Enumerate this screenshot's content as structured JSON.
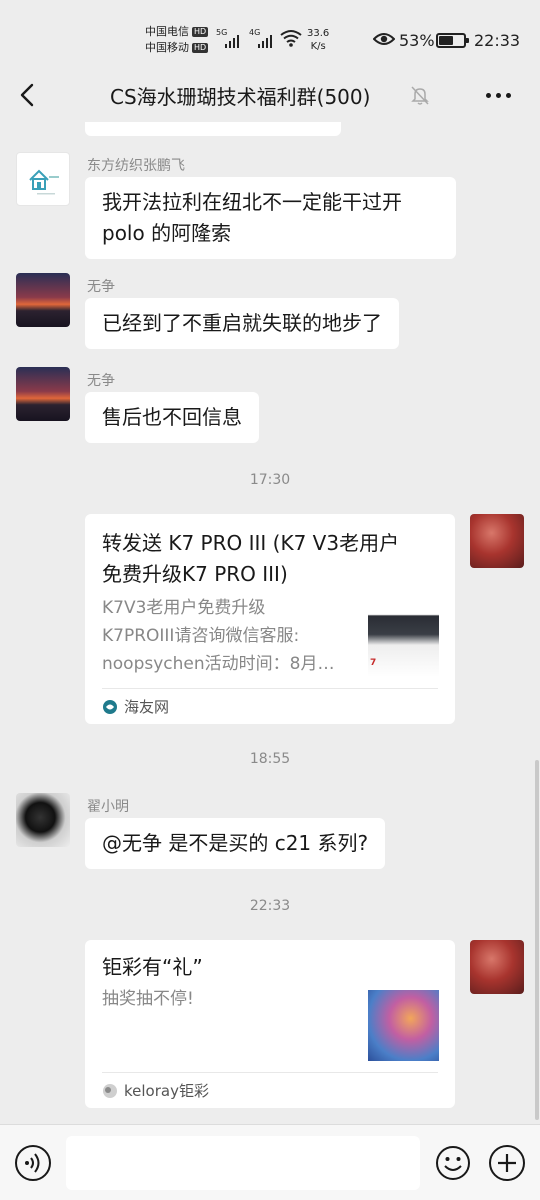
{
  "status_bar": {
    "carrier1": "中国电信",
    "carrier2": "中国移动",
    "hd_label": "HD",
    "sim1_network": "5G",
    "sim2_network": "4G",
    "net_speed_value": "33.6",
    "net_speed_unit": "K/s",
    "battery_percent": "53%",
    "battery_level": 0.53,
    "time": "22:33"
  },
  "header": {
    "title": "CS海水珊瑚技术福利群(500)"
  },
  "messages": [
    {
      "sender": "东方纺织张鹏飞",
      "text_line1": "我开法拉利在纽北不一定能干过开",
      "text_line2": "polo 的阿隆索"
    },
    {
      "sender": "无争",
      "text": "已经到了不重启就失联的地步了"
    },
    {
      "sender": "无争",
      "text": "售后也不回信息"
    },
    {
      "timestamp": "17:30"
    },
    {
      "title_line1": "转发送 K7 PRO III (K7 V3老用户",
      "title_line2": "免费升级K7 PRO III)",
      "desc_line1": "K7V3老用户免费升级",
      "desc_line2": "K7PROIII请咨询微信客服:",
      "desc_line3": "noopsychen活动时间：8月…",
      "source": "海友网"
    },
    {
      "timestamp": "18:55"
    },
    {
      "sender": "翟小明",
      "text": "@无争  是不是买的 c21 系列?"
    },
    {
      "timestamp": "22:33"
    },
    {
      "title": "钜彩有“礼”",
      "desc": "抽奖抽不停!",
      "source": "keloray钜彩"
    }
  ],
  "colors": {
    "background": "#ededed",
    "bubble": "#ffffff",
    "meta_text": "#8a8a8a"
  },
  "icons": {
    "back": "chevron-left-icon",
    "mute": "bell-off-icon",
    "more": "ellipsis-icon",
    "voice": "voice-icon",
    "emoji": "emoji-icon",
    "plus": "plus-icon"
  }
}
